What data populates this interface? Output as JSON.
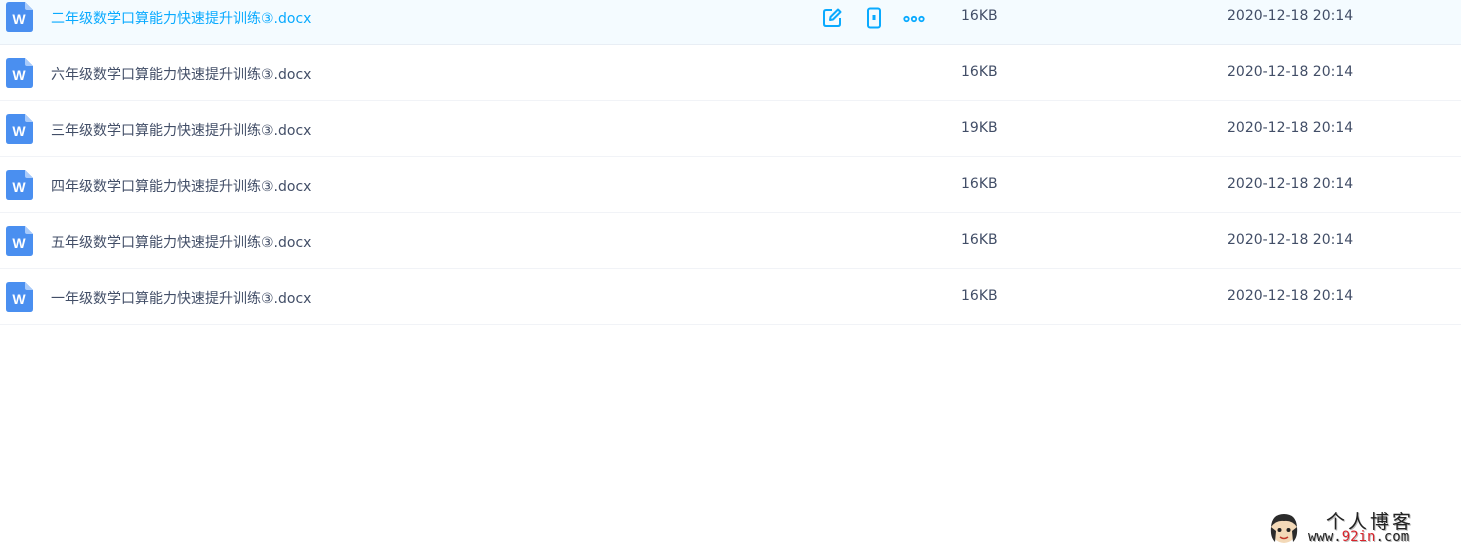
{
  "colors": {
    "accent": "#09aaff",
    "text": "#424e67",
    "hover_row_bg": "#f4fbff",
    "row_divider": "#f1f3f7",
    "word_icon_blue": "#4a8ff0"
  },
  "row_actions": {
    "icons": [
      "edit-icon",
      "mobile-icon",
      "more-icon"
    ]
  },
  "files": [
    {
      "name": "二年级数学口算能力快速提升训练③.docx",
      "size": "16KB",
      "modified": "2020-12-18 20:14",
      "icon": "word-doc-icon"
    },
    {
      "name": "六年级数学口算能力快速提升训练③.docx",
      "size": "16KB",
      "modified": "2020-12-18 20:14",
      "icon": "word-doc-icon"
    },
    {
      "name": "三年级数学口算能力快速提升训练③.docx",
      "size": "19KB",
      "modified": "2020-12-18 20:14",
      "icon": "word-doc-icon"
    },
    {
      "name": "四年级数学口算能力快速提升训练③.docx",
      "size": "16KB",
      "modified": "2020-12-18 20:14",
      "icon": "word-doc-icon"
    },
    {
      "name": "五年级数学口算能力快速提升训练③.docx",
      "size": "16KB",
      "modified": "2020-12-18 20:14",
      "icon": "word-doc-icon"
    },
    {
      "name": "一年级数学口算能力快速提升训练③.docx",
      "size": "16KB",
      "modified": "2020-12-18 20:14",
      "icon": "word-doc-icon"
    }
  ],
  "watermark": {
    "title": "个人博客",
    "url_prefix": "www.",
    "url_highlight": "92in",
    "url_suffix": ".com"
  }
}
